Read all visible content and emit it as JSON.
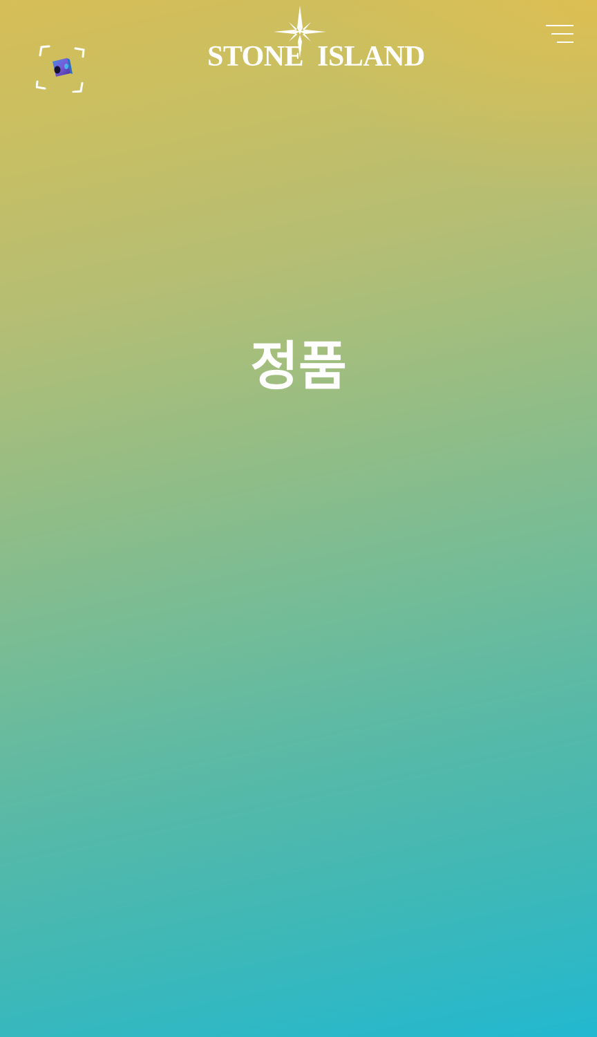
{
  "brand": {
    "name_left": "STONE",
    "name_right": "ISLAND",
    "logo_icon": "compass-rose-icon"
  },
  "header": {
    "scan_icon": "scan-viewfinder-icon",
    "menu_icon": "hamburger-menu-icon"
  },
  "main": {
    "headline": "정품"
  },
  "colors": {
    "gradient_top": "#d6be57",
    "gradient_middle": "#92bd86",
    "gradient_bottom": "#22b8d0",
    "foreground": "#ffffff"
  }
}
